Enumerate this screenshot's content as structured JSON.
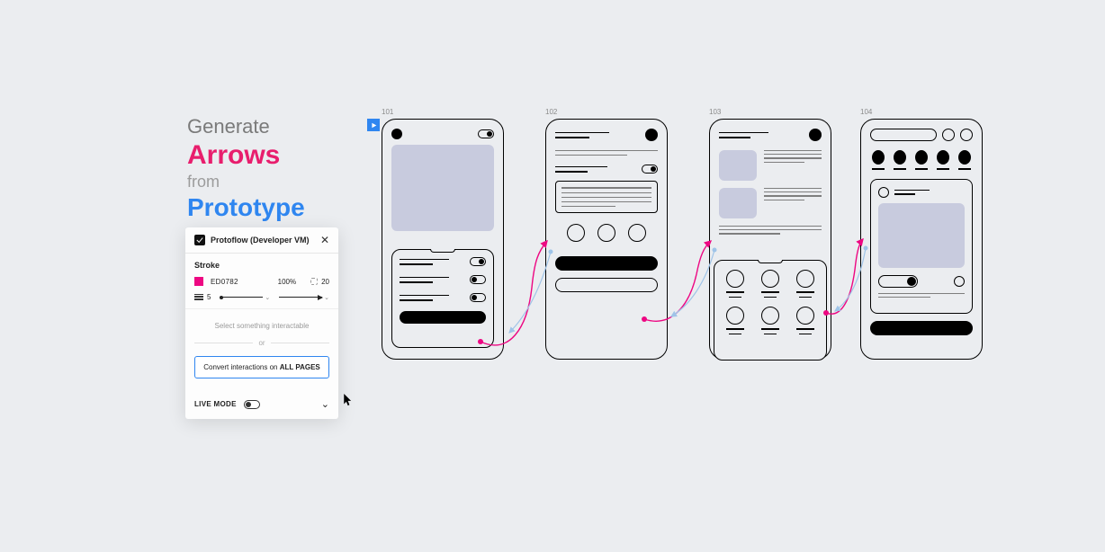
{
  "heading": {
    "line1": "Generate",
    "line2": "Arrows",
    "line3": "from",
    "line4": "Prototype"
  },
  "panel": {
    "title": "Protoflow (Developer VM)",
    "stroke": {
      "section_label": "Stroke",
      "hex": "ED0782",
      "opacity": "100%",
      "corner": "20",
      "weight": "5"
    },
    "hint": "Select something interactable",
    "or": "or",
    "convert_prefix": "Convert interactions on ",
    "convert_bold": "ALL PAGES",
    "footer": {
      "live_mode": "LIVE MODE"
    }
  },
  "frames": {
    "f1": "101",
    "f2": "102",
    "f3": "103",
    "f4": "104"
  },
  "colors": {
    "magenta": "#ed0782",
    "blue": "#2f86f0",
    "lightblue": "#b3d1ef"
  }
}
